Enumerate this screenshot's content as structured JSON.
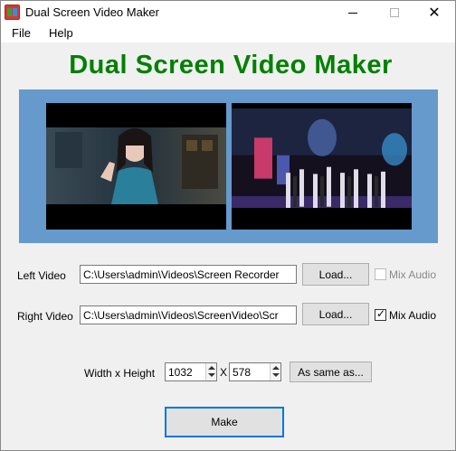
{
  "window": {
    "title": "Dual Screen Video Maker"
  },
  "menu": {
    "file": "File",
    "help": "Help"
  },
  "heading": "Dual Screen Video Maker",
  "colors": {
    "heading": "#008000",
    "preview_panel": "#6699cc",
    "focus_border": "#0078d7"
  },
  "left_video": {
    "label": "Left Video",
    "path": "C:\\Users\\admin\\Videos\\Screen Recorder",
    "load_label": "Load...",
    "mix_audio_label": "Mix Audio",
    "mix_audio_checked": false,
    "mix_audio_enabled": false
  },
  "right_video": {
    "label": "Right Video",
    "path": "C:\\Users\\admin\\Videos\\ScreenVideo\\Scr",
    "load_label": "Load...",
    "mix_audio_label": "Mix Audio",
    "mix_audio_checked": true,
    "mix_audio_enabled": true
  },
  "size": {
    "label": "Width x Height",
    "width": "1032",
    "separator": "X",
    "height": "578",
    "same_as_label": "As same as..."
  },
  "make_label": "Make"
}
